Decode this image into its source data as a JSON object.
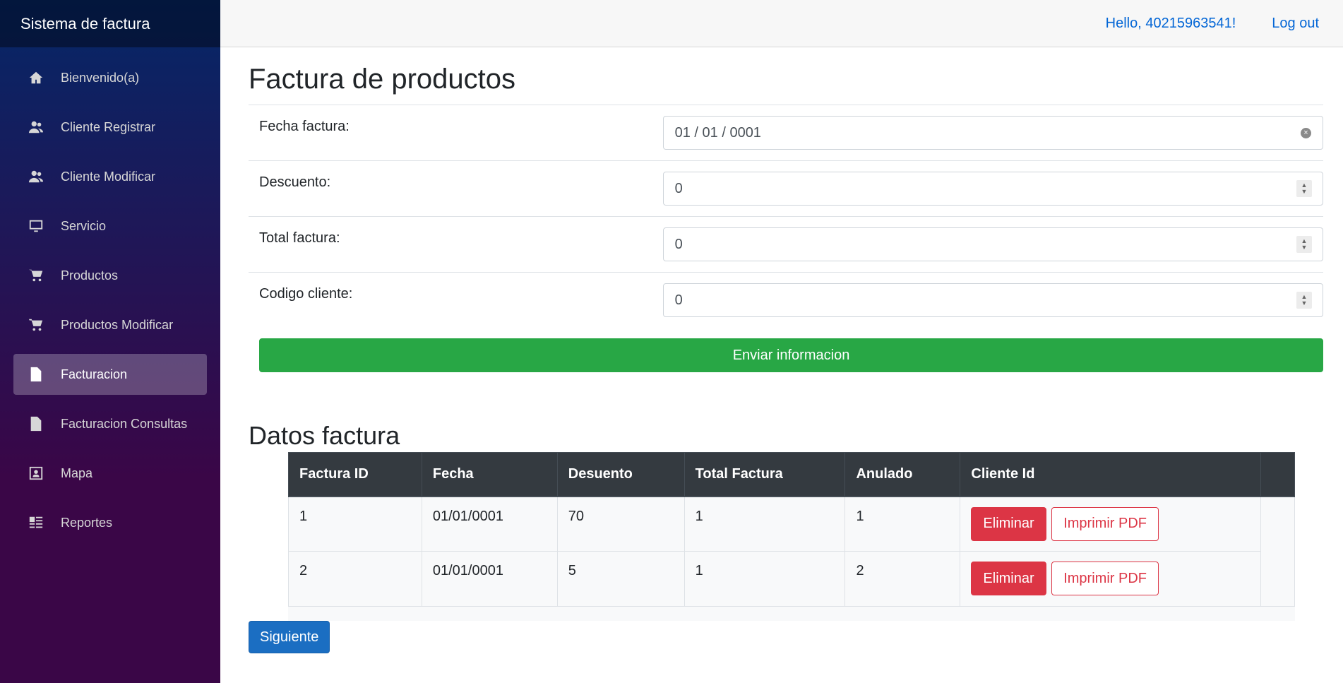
{
  "brand": "Sistema de factura",
  "sidebar": {
    "items": [
      {
        "label": "Bienvenido(a)",
        "icon": "home-icon"
      },
      {
        "label": "Cliente Registrar",
        "icon": "people-icon"
      },
      {
        "label": "Cliente Modificar",
        "icon": "people-icon"
      },
      {
        "label": "Servicio",
        "icon": "monitor-icon"
      },
      {
        "label": "Productos",
        "icon": "cart-icon"
      },
      {
        "label": "Productos Modificar",
        "icon": "cart-icon"
      },
      {
        "label": "Facturacion",
        "icon": "document-icon",
        "active": true
      },
      {
        "label": "Facturacion Consultas",
        "icon": "document-icon"
      },
      {
        "label": "Mapa",
        "icon": "map-icon"
      },
      {
        "label": "Reportes",
        "icon": "list-icon"
      }
    ]
  },
  "topbar": {
    "greeting": "Hello, 40215963541!",
    "logout": "Log out"
  },
  "page": {
    "title": "Factura de productos",
    "form": {
      "fecha_label": "Fecha factura:",
      "fecha_value": "01 / 01 / 0001",
      "descuento_label": "Descuento:",
      "descuento_value": "0",
      "total_label": "Total factura:",
      "total_value": "0",
      "codigo_label": "Codigo cliente:",
      "codigo_value": "0",
      "submit": "Enviar informacion"
    },
    "table_title": "Datos factura",
    "table": {
      "headers": [
        "Factura ID",
        "Fecha",
        "Desuento",
        "Total Factura",
        "Anulado",
        "Cliente Id"
      ],
      "rows": [
        [
          "1",
          "01/01/0001",
          "70",
          "1",
          "1"
        ],
        [
          "2",
          "01/01/0001",
          "5",
          "1",
          "2"
        ]
      ],
      "delete_label": "Eliminar",
      "pdf_label": "Imprimir PDF"
    },
    "next": "Siguiente"
  },
  "colors": {
    "success": "#28a745",
    "danger": "#dc3545",
    "primary": "#1b6ec2",
    "link": "#0366d6"
  }
}
